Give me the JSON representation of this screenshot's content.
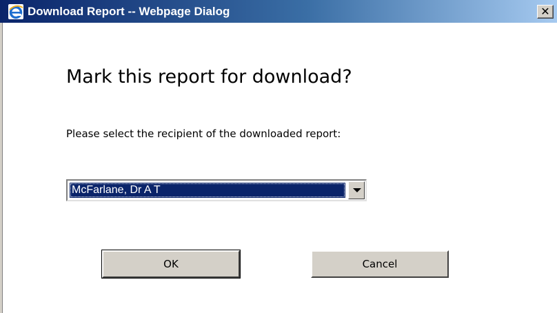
{
  "window": {
    "title": "Download Report -- Webpage Dialog",
    "close_label": "✕",
    "app_icon": "internet-explorer-icon"
  },
  "dialog": {
    "heading": "Mark this report for download?",
    "prompt": "Please select the recipient of the downloaded report:",
    "recipient_select": {
      "selected_value": "McFarlane, Dr A T"
    },
    "ok_label": "OK",
    "cancel_label": "Cancel"
  },
  "colors": {
    "titlebar_start": "#0a246a",
    "titlebar_end": "#a6caf0",
    "button_face": "#d4d0c8",
    "selection": "#0a246a"
  }
}
